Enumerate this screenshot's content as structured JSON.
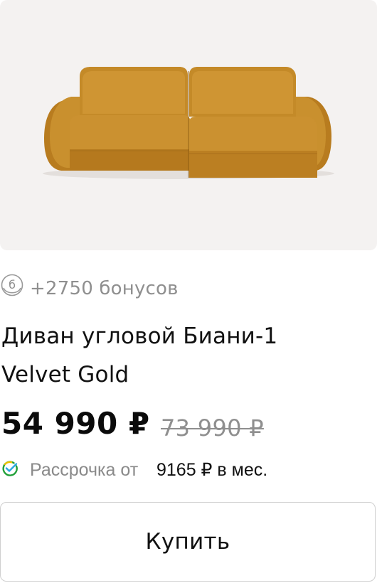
{
  "product": {
    "image_icon": "sofa-image",
    "bonus": {
      "icon": "bonus-coin-icon",
      "icon_digit": "б",
      "text": "+2750 бонусов"
    },
    "title_line1": "Диван угловой Биани-1",
    "title_line2": "Velvet Gold",
    "price": {
      "current": "54 990 ₽",
      "old": "73 990 ₽"
    },
    "installment": {
      "icon": "sber-check-icon",
      "label": "Рассрочка от",
      "amount": "9165 ₽ в мес."
    },
    "buy_button_label": "Купить"
  },
  "colors": {
    "image_bg": "#f4f2f1",
    "sofa": "#c98f2b",
    "muted_text": "#8f8f8f",
    "sber_green": "#21a038",
    "button_border": "#cfcfcf"
  }
}
